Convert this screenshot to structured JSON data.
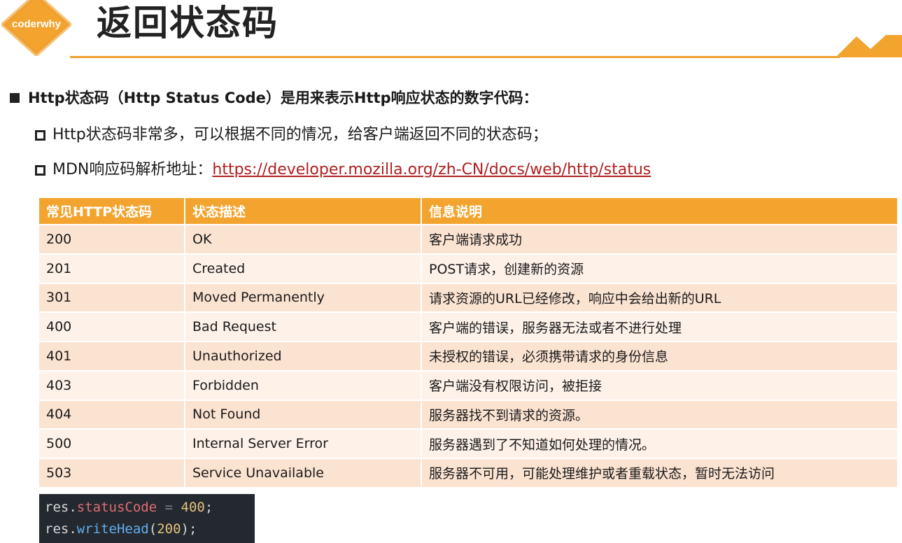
{
  "header": {
    "logo_text": "coderwhy",
    "title": "返回状态码"
  },
  "colors": {
    "accent": "#f2a42f",
    "row_odd": "#fbe3d2",
    "row_even": "#fdf1e8",
    "link": "#b02020",
    "code_bg": "#24292f"
  },
  "content": {
    "main_bullet": "Http状态码（Http Status Code）是用来表示Http响应状态的数字代码：",
    "sub1": "Http状态码非常多，可以根据不同的情况，给客户端返回不同的状态码；",
    "sub2_prefix": "MDN响应码解析地址：",
    "sub2_link": "https://developer.mozilla.org/zh-CN/docs/web/http/status"
  },
  "table": {
    "headers": [
      "常见HTTP状态码",
      "状态描述",
      "信息说明"
    ],
    "rows": [
      [
        "200",
        "OK",
        "客户端请求成功"
      ],
      [
        "201",
        "Created",
        "POST请求，创建新的资源"
      ],
      [
        "301",
        "Moved Permanently",
        "请求资源的URL已经修改，响应中会给出新的URL"
      ],
      [
        "400",
        "Bad Request",
        "客户端的错误，服务器无法或者不进行处理"
      ],
      [
        "401",
        "Unauthorized",
        "未授权的错误，必须携带请求的身份信息"
      ],
      [
        "403",
        "Forbidden",
        "客户端没有权限访问，被拒接"
      ],
      [
        "404",
        "Not Found",
        "服务器找不到请求的资源。"
      ],
      [
        "500",
        "Internal Server Error",
        "服务器遇到了不知道如何处理的情况。"
      ],
      [
        "503",
        "Service Unavailable",
        "服务器不可用，可能处理维护或者重载状态，暂时无法访问"
      ]
    ]
  },
  "code": {
    "line1": {
      "obj": "res",
      "dot": ".",
      "prop": "statusCode",
      "op": " = ",
      "num": "400",
      "end": ";"
    },
    "line2": {
      "obj": "res",
      "dot": ".",
      "fn": "writeHead",
      "open": "(",
      "num": "200",
      "close": ");"
    }
  }
}
